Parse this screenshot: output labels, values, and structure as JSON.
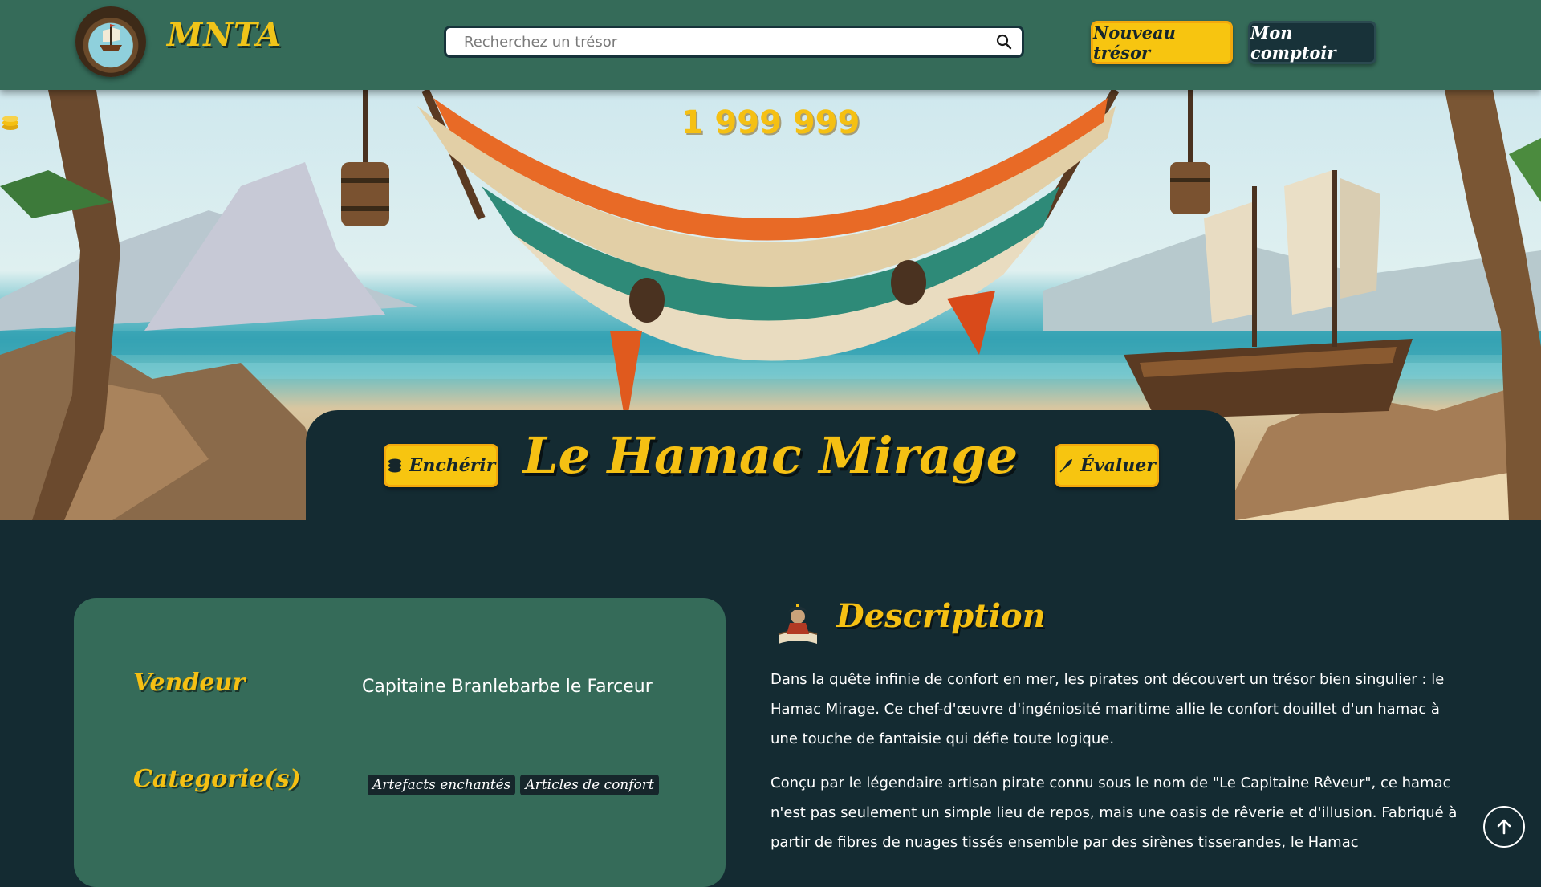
{
  "header": {
    "brand": "MNTA",
    "search_placeholder": "Recherchez un trésor",
    "new_treasure_label": "Nouveau trésor",
    "my_counter_label": "Mon comptoir"
  },
  "hero": {
    "price": "1 999 999"
  },
  "item": {
    "title": "Le Hamac Mirage",
    "bid_label": "Enchérir",
    "rate_label": "Évaluer"
  },
  "info": {
    "seller_label": "Vendeur",
    "seller_value": "Capitaine Branlebarbe le Farceur",
    "categories_label": "Categorie(s)",
    "categories": [
      "Artefacts enchantés",
      "Articles de confort"
    ]
  },
  "description": {
    "heading": "Description",
    "paragraphs": [
      "Dans la quête infinie de confort en mer, les pirates ont découvert un trésor bien singulier : le Hamac Mirage. Ce chef-d'œuvre d'ingéniosité maritime allie le confort douillet d'un hamac à une touche de fantaisie qui défie toute logique.",
      "Conçu par le légendaire artisan pirate connu sous le nom de \"Le Capitaine Rêveur\", ce hamac n'est pas seulement un simple lieu de repos, mais une oasis de rêverie et d'illusion. Fabriqué à partir de fibres de nuages tissés ensemble par des sirènes tisserandes, le Hamac"
    ]
  },
  "colors": {
    "navbar": "#356b59",
    "background": "#142b32",
    "accent_yellow": "#f5c013",
    "card": "#356b59"
  }
}
